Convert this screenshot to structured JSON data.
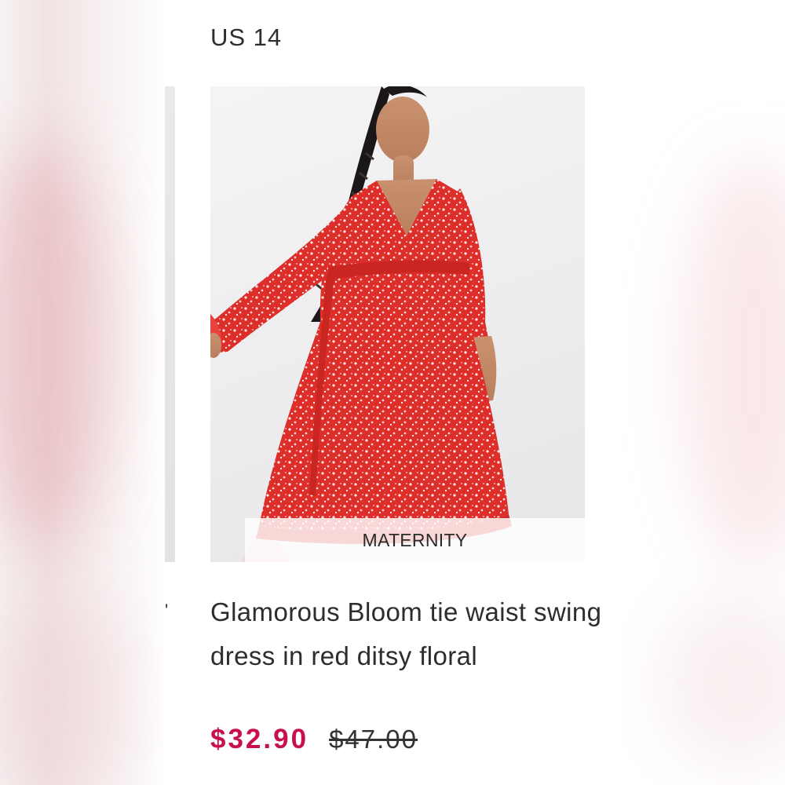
{
  "listing": {
    "size": "US 14",
    "badge": "MATERNITY",
    "title": "Glamorous Bloom tie waist swing dress in red ditsy floral",
    "price_sale": "$32.90",
    "price_original": "$47.00",
    "prev_title_fragment": "'"
  },
  "colors": {
    "sale_price": "#c8104c",
    "dress": "#e0302c",
    "text": "#2d2d2d"
  },
  "images": {
    "product_photo": "product-photo-woman-in-red-floral-dress"
  }
}
